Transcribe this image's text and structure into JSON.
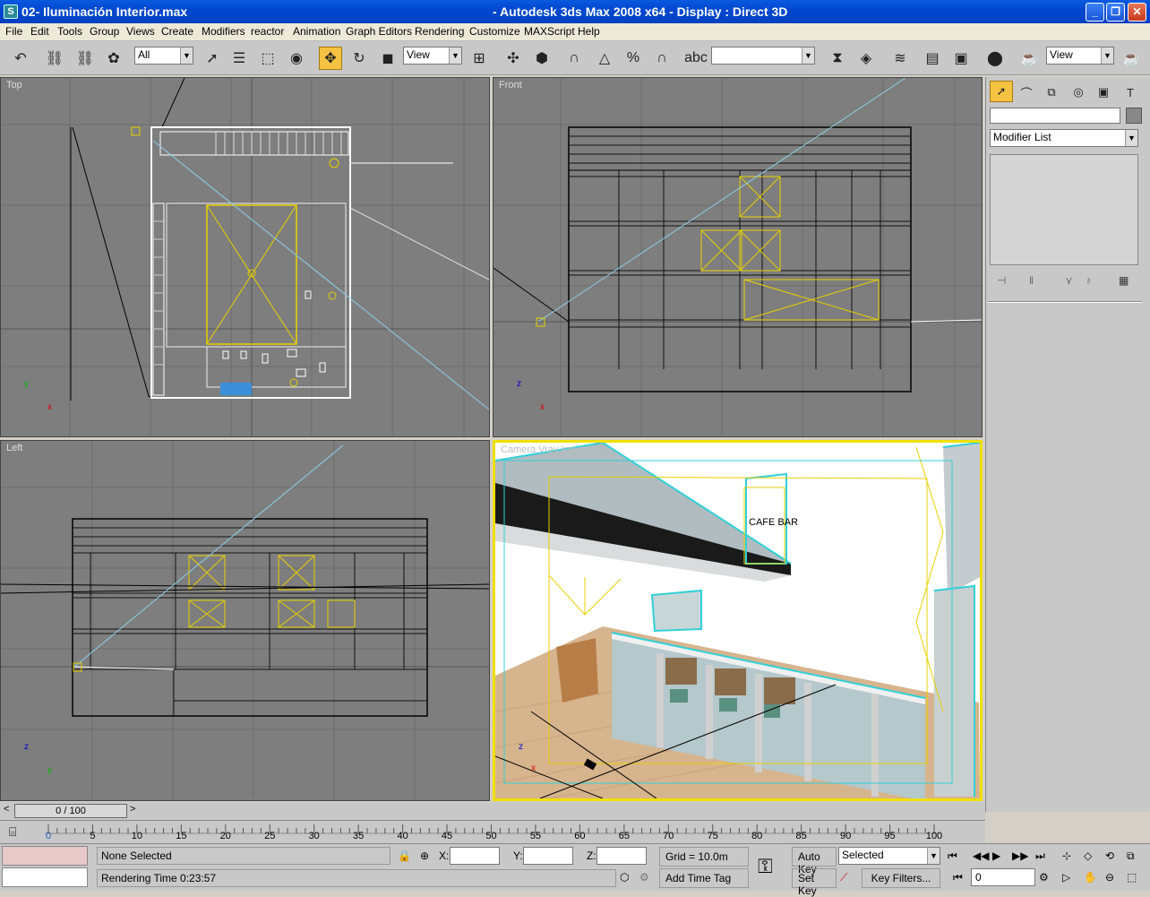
{
  "window": {
    "title_file": "02- Iluminación Interior.max",
    "title_app": "- Autodesk 3ds Max 2008 x64        - Display : Direct 3D",
    "app_icon_letter": "S",
    "min_glyph": "_",
    "max_glyph": "❐",
    "close_glyph": "✕"
  },
  "menu": [
    "File",
    "Edit",
    "Tools",
    "Group",
    "Views",
    "Create",
    "Modifiers",
    "reactor",
    "Animation",
    "Graph Editors",
    "Rendering",
    "Customize",
    "MAXScript",
    "Help"
  ],
  "toolbar": {
    "selection_filter": "All",
    "reference_coord": "View",
    "named_selection": "",
    "render_view": "View",
    "combo_arrow": "▼"
  },
  "viewports": {
    "top": {
      "label": "Top",
      "axis_y": "y",
      "axis_x": "x"
    },
    "front": {
      "label": "Front",
      "axis_y": "z",
      "axis_x": "x"
    },
    "left": {
      "label": "Left",
      "axis_y": "z",
      "axis_x": "y"
    },
    "camera": {
      "label": "Camera Vray Interior 01",
      "axis_y": "z",
      "axis_x": "x",
      "sign_text": "CAFE BAR"
    }
  },
  "command_panel": {
    "modifier_list": "Modifier List",
    "name_field": ""
  },
  "time": {
    "slider": "0 / 100",
    "prev": "<",
    "next": ">",
    "ticks": [
      "0",
      "5",
      "10",
      "15",
      "20",
      "25",
      "30",
      "35",
      "40",
      "45",
      "50",
      "55",
      "60",
      "65",
      "70",
      "75",
      "80",
      "85",
      "90",
      "95",
      "100"
    ]
  },
  "status": {
    "selection": "None Selected",
    "prompt": "Rendering Time  0:23:57",
    "x_label": "X:",
    "y_label": "Y:",
    "z_label": "Z:",
    "x_value": "",
    "y_value": "",
    "z_value": "",
    "grid": "Grid = 10.0m",
    "add_time_tag": "Add Time Tag",
    "auto_key": "Auto Key",
    "set_key": "Set Key",
    "key_mode": "Selected",
    "key_filters": "Key Filters...",
    "frame": "0"
  },
  "colors": {
    "titlebar": "#0048d0",
    "viewport_bg": "#7e7e7e",
    "active_viewport": "#f0e000",
    "light_wire": "#e8d000",
    "glass_cyan": "#30d0d8",
    "floor": "#d6b48e"
  }
}
